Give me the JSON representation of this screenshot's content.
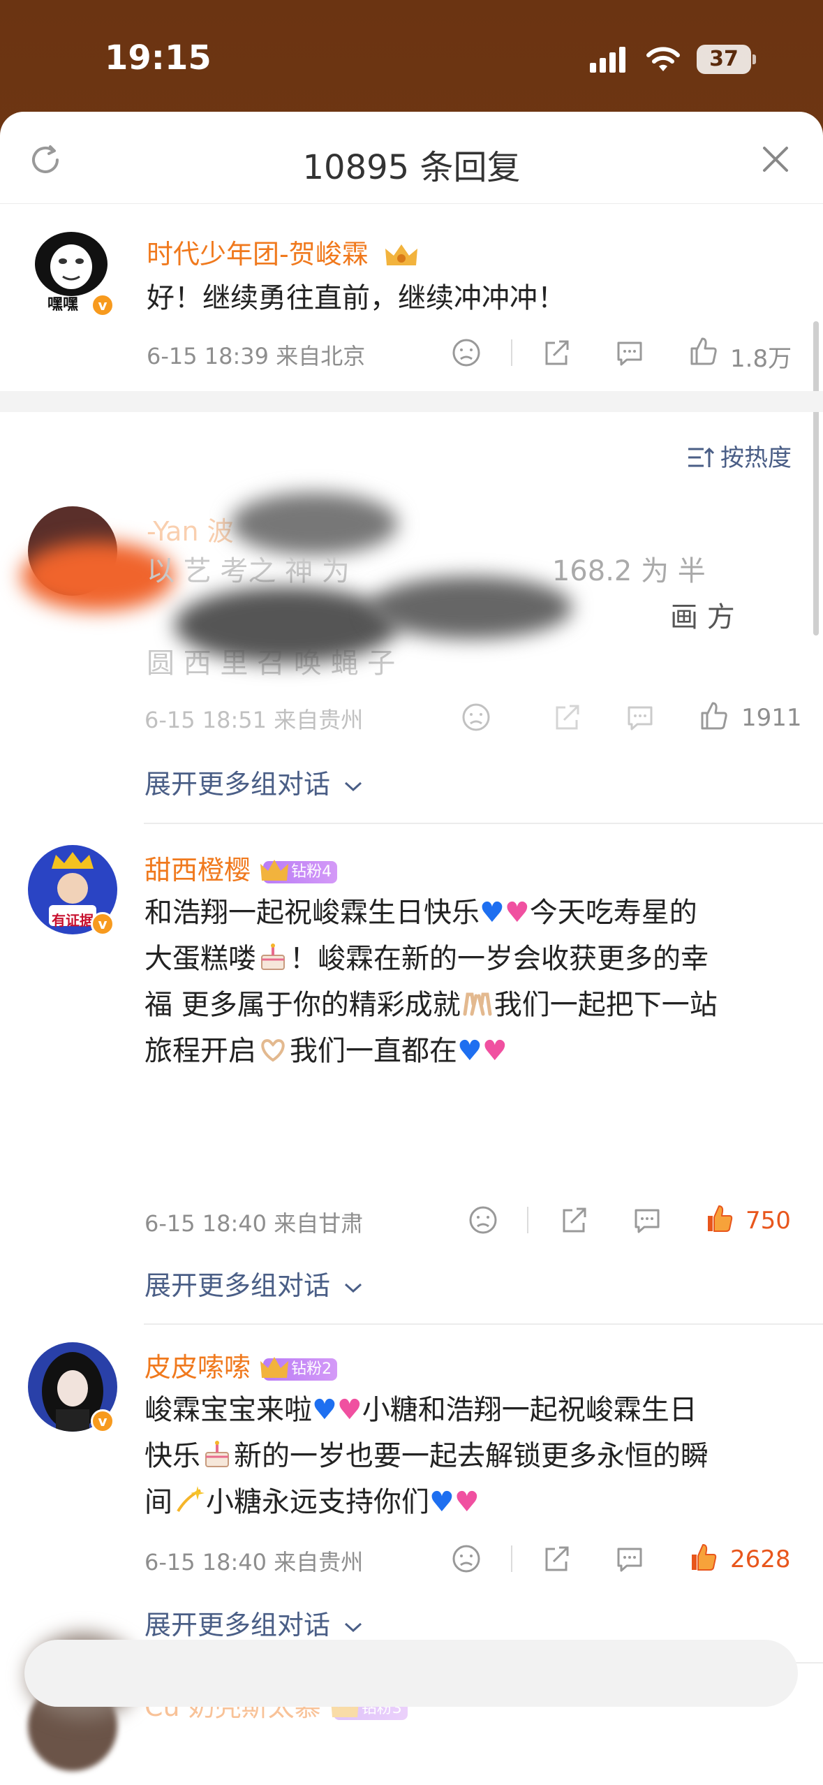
{
  "status": {
    "time": "19:15",
    "battery": "37"
  },
  "header": {
    "title": "10895 条回复"
  },
  "top_comment": {
    "username": "时代少年团-贺峻霖",
    "avatar_text": "嘿嘿",
    "content": "好！继续勇往直前，继续冲冲冲！",
    "meta": "6-15 18:39  来自北京",
    "likes": "1.8万"
  },
  "sort_label": "按热度",
  "comments": [
    {
      "username": "-Yan 波",
      "content_line1": "以 艺 考之 神 为",
      "content_num": "168.2 为 半",
      "content_line2": "画 方",
      "content_line3": "圆 西 里 召 唤 蝇 子",
      "meta": "6-15 18:51  来自贵州",
      "likes": "1911",
      "expand": "展开更多组对话"
    },
    {
      "username": "甜西橙樱",
      "badge": "钻粉4",
      "avatar_text": "有证据",
      "content_lines": [
        "和浩翔一起祝峻霖生日快乐",
        "今天吃寿星的",
        "大蛋糕喽",
        "！峻霖在新的一岁会收获更多的幸",
        "福 更多属于你的精彩成就",
        "我们一起把下一站",
        "旅程开启",
        "我们一直都在"
      ],
      "meta": "6-15 18:40  来自甘肃",
      "likes": "750",
      "expand": "展开更多组对话"
    },
    {
      "username": "皮皮嗦嗦",
      "badge": "钻粉2",
      "content_lines": [
        "峻霖宝宝来啦",
        "小糖和浩翔一起祝峻霖生日",
        "快乐",
        "新的一岁也要一起去解锁更多永恒的瞬",
        "间",
        "小糖永远支持你们"
      ],
      "meta": "6-15 18:40  来自贵州",
      "likes": "2628",
      "expand": "展开更多组对话"
    },
    {
      "username": "Cu 奶壳斯太慕",
      "badge": "钻粉3"
    }
  ],
  "colors": {
    "accent": "#f0791d",
    "link": "#4a5e86",
    "liked": "#e8561c"
  }
}
